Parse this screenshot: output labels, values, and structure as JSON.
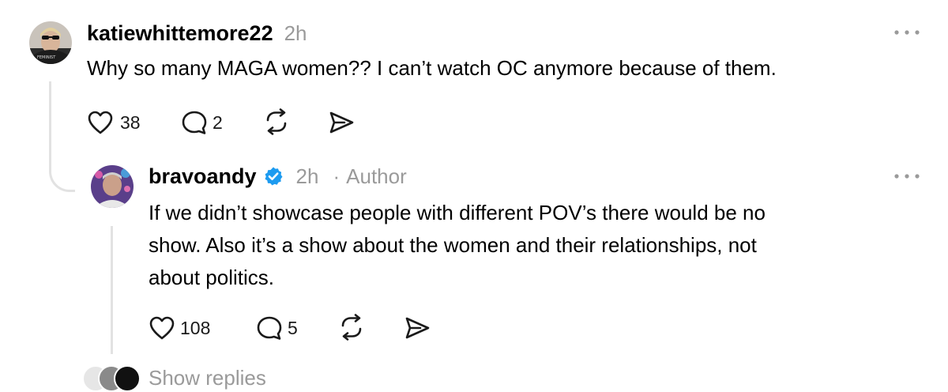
{
  "comments": [
    {
      "username": "katiewhittemore22",
      "time": "2h",
      "text": "Why so many MAGA women?? I can’t watch OC anymore because of them.",
      "likes": "38",
      "replies": "2",
      "more_icon": "more-dots-icon"
    },
    {
      "username": "bravoandy",
      "verified": true,
      "time": "2h",
      "separator": "·",
      "author_label": "Author",
      "text_lines": [
        "If we didn’t showcase people with different POV’s there would be no",
        "show. Also it’s a show about the women and their relationships, not",
        "about politics."
      ],
      "likes": "108",
      "replies": "5",
      "more_icon": "more-dots-icon"
    }
  ],
  "show_replies": "Show replies",
  "colors": {
    "text": "#000000",
    "muted": "#9a9a9a",
    "verified": "#1d9bf0",
    "thread_line": "#e2e2e2"
  },
  "icons": [
    "heart-icon",
    "comment-icon",
    "repost-icon",
    "share-icon",
    "verified-badge-icon",
    "more-dots-icon"
  ]
}
